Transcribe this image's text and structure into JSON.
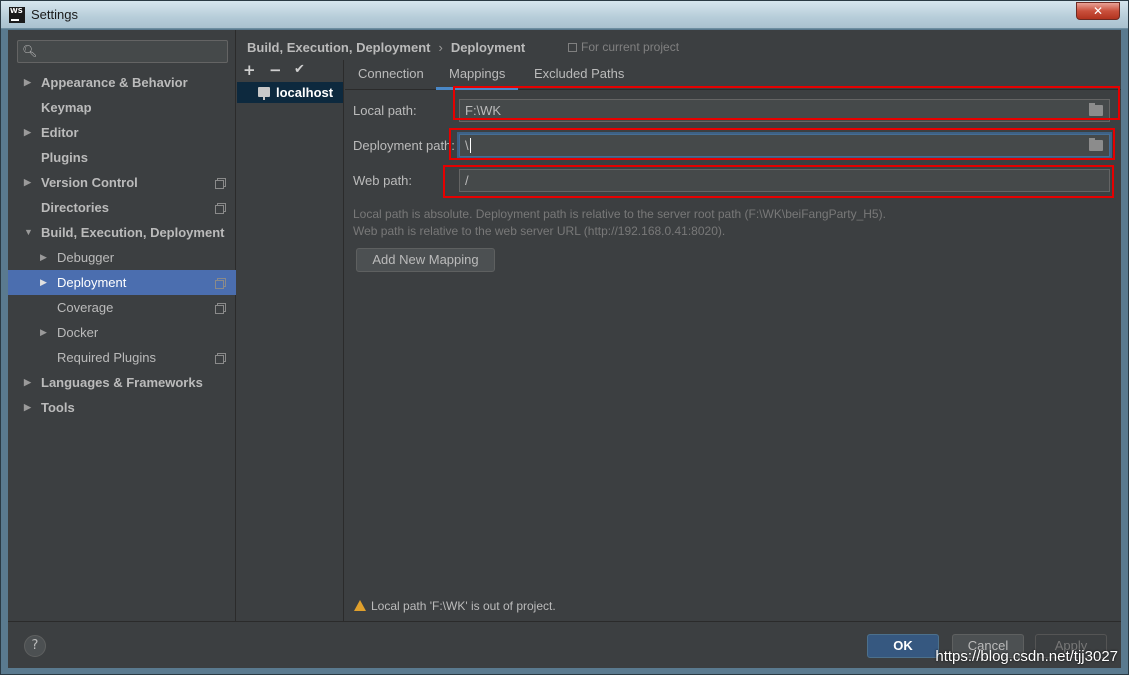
{
  "window": {
    "title": "Settings",
    "app_icon": "WS",
    "close_label": "✕"
  },
  "search": {
    "placeholder": ""
  },
  "sidebar": {
    "items": [
      {
        "label": "Appearance & Behavior",
        "expanded": false
      },
      {
        "label": "Keymap"
      },
      {
        "label": "Editor",
        "expanded": false
      },
      {
        "label": "Plugins"
      },
      {
        "label": "Version Control",
        "expanded": false
      },
      {
        "label": "Directories"
      },
      {
        "label": "Build, Execution, Deployment",
        "expanded": true
      },
      {
        "label": "Debugger"
      },
      {
        "label": "Deployment",
        "selected": true
      },
      {
        "label": "Coverage"
      },
      {
        "label": "Docker"
      },
      {
        "label": "Required Plugins"
      },
      {
        "label": "Languages & Frameworks"
      },
      {
        "label": "Tools"
      }
    ]
  },
  "breadcrumb": {
    "parent": "Build, Execution, Deployment",
    "separator": "›",
    "current": "Deployment",
    "scope": "For current project"
  },
  "servers": {
    "add": "+",
    "remove": "−",
    "check": "✔",
    "items": [
      "localhost"
    ]
  },
  "tabs": [
    "Connection",
    "Mappings",
    "Excluded Paths"
  ],
  "active_tab": "Mappings",
  "mapping": {
    "local_path_label": "Local path:",
    "local_path_value": "F:\\WK",
    "deployment_path_label": "Deployment path:",
    "deployment_path_value": "\\",
    "web_path_label": "Web path:",
    "web_path_value": "/",
    "hint_line1": "Local path is absolute. Deployment path is relative to the server root path (F:\\WK\\beiFangParty_H5).",
    "hint_line2": "Web path is relative to the web server URL (http://192.168.0.41:8020).",
    "add_mapping_label": "Add New Mapping"
  },
  "warning": "Local path 'F:\\WK' is out of project.",
  "footer": {
    "help": "?",
    "ok": "OK",
    "cancel": "Cancel",
    "apply": "Apply"
  },
  "watermark": "https://blog.csdn.net/tjj3027",
  "colors": {
    "selection": "#4b6eaf",
    "accent": "#4a88c7",
    "highlight_box": "#e60000",
    "ok_button": "#365880"
  }
}
